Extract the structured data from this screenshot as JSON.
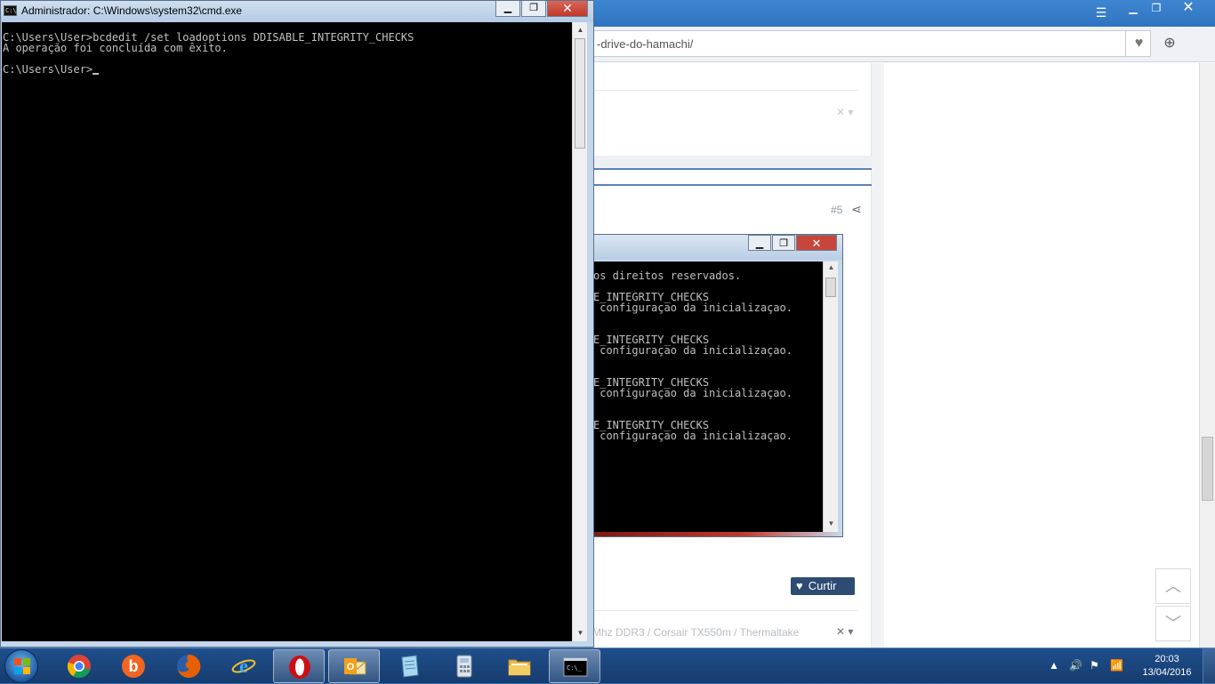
{
  "browser": {
    "url": "-drive-do-hamachi/",
    "post_number": "#5",
    "like_label": "Curtir",
    "signature_text": "Mhz DDR3 / Corsair TX550m / Thermaltake"
  },
  "cmd_main": {
    "title": "Administrador: C:\\Windows\\system32\\cmd.exe",
    "lines": [
      "C:\\Users\\User>bcdedit /set loadoptions DDISABLE_INTEGRITY_CHECKS",
      "A operação foi concluída com êxito.",
      "",
      "C:\\Users\\User>"
    ]
  },
  "cmd_secondary": {
    "lines": [
      "os direitos reservados.",
      "",
      "E_INTEGRITY_CHECKS",
      " configuraçao da inicializaçao.",
      "",
      "",
      "E_INTEGRITY_CHECKS",
      " configuraçao da inicializaçao.",
      "",
      "",
      "E_INTEGRITY_CHECKS",
      " configuraçao da inicializaçao.",
      "",
      "",
      "E_INTEGRITY_CHECKS",
      " configuraçao da inicializaçao."
    ]
  },
  "taskbar": {
    "apps": [
      {
        "name": "chrome",
        "icon": "chrome-icon"
      },
      {
        "name": "bing",
        "icon": "bing-icon"
      },
      {
        "name": "firefox",
        "icon": "firefox-icon"
      },
      {
        "name": "internet-explorer",
        "icon": "ie-icon"
      },
      {
        "name": "opera",
        "icon": "opera-icon"
      },
      {
        "name": "outlook",
        "icon": "outlook-icon"
      },
      {
        "name": "notepad",
        "icon": "notepad-icon"
      },
      {
        "name": "calculator",
        "icon": "calculator-icon"
      },
      {
        "name": "explorer",
        "icon": "folder-icon"
      },
      {
        "name": "cmd",
        "icon": "cmd-icon",
        "label": "C:\\_"
      }
    ],
    "time": "20:03",
    "date": "13/04/2016"
  }
}
